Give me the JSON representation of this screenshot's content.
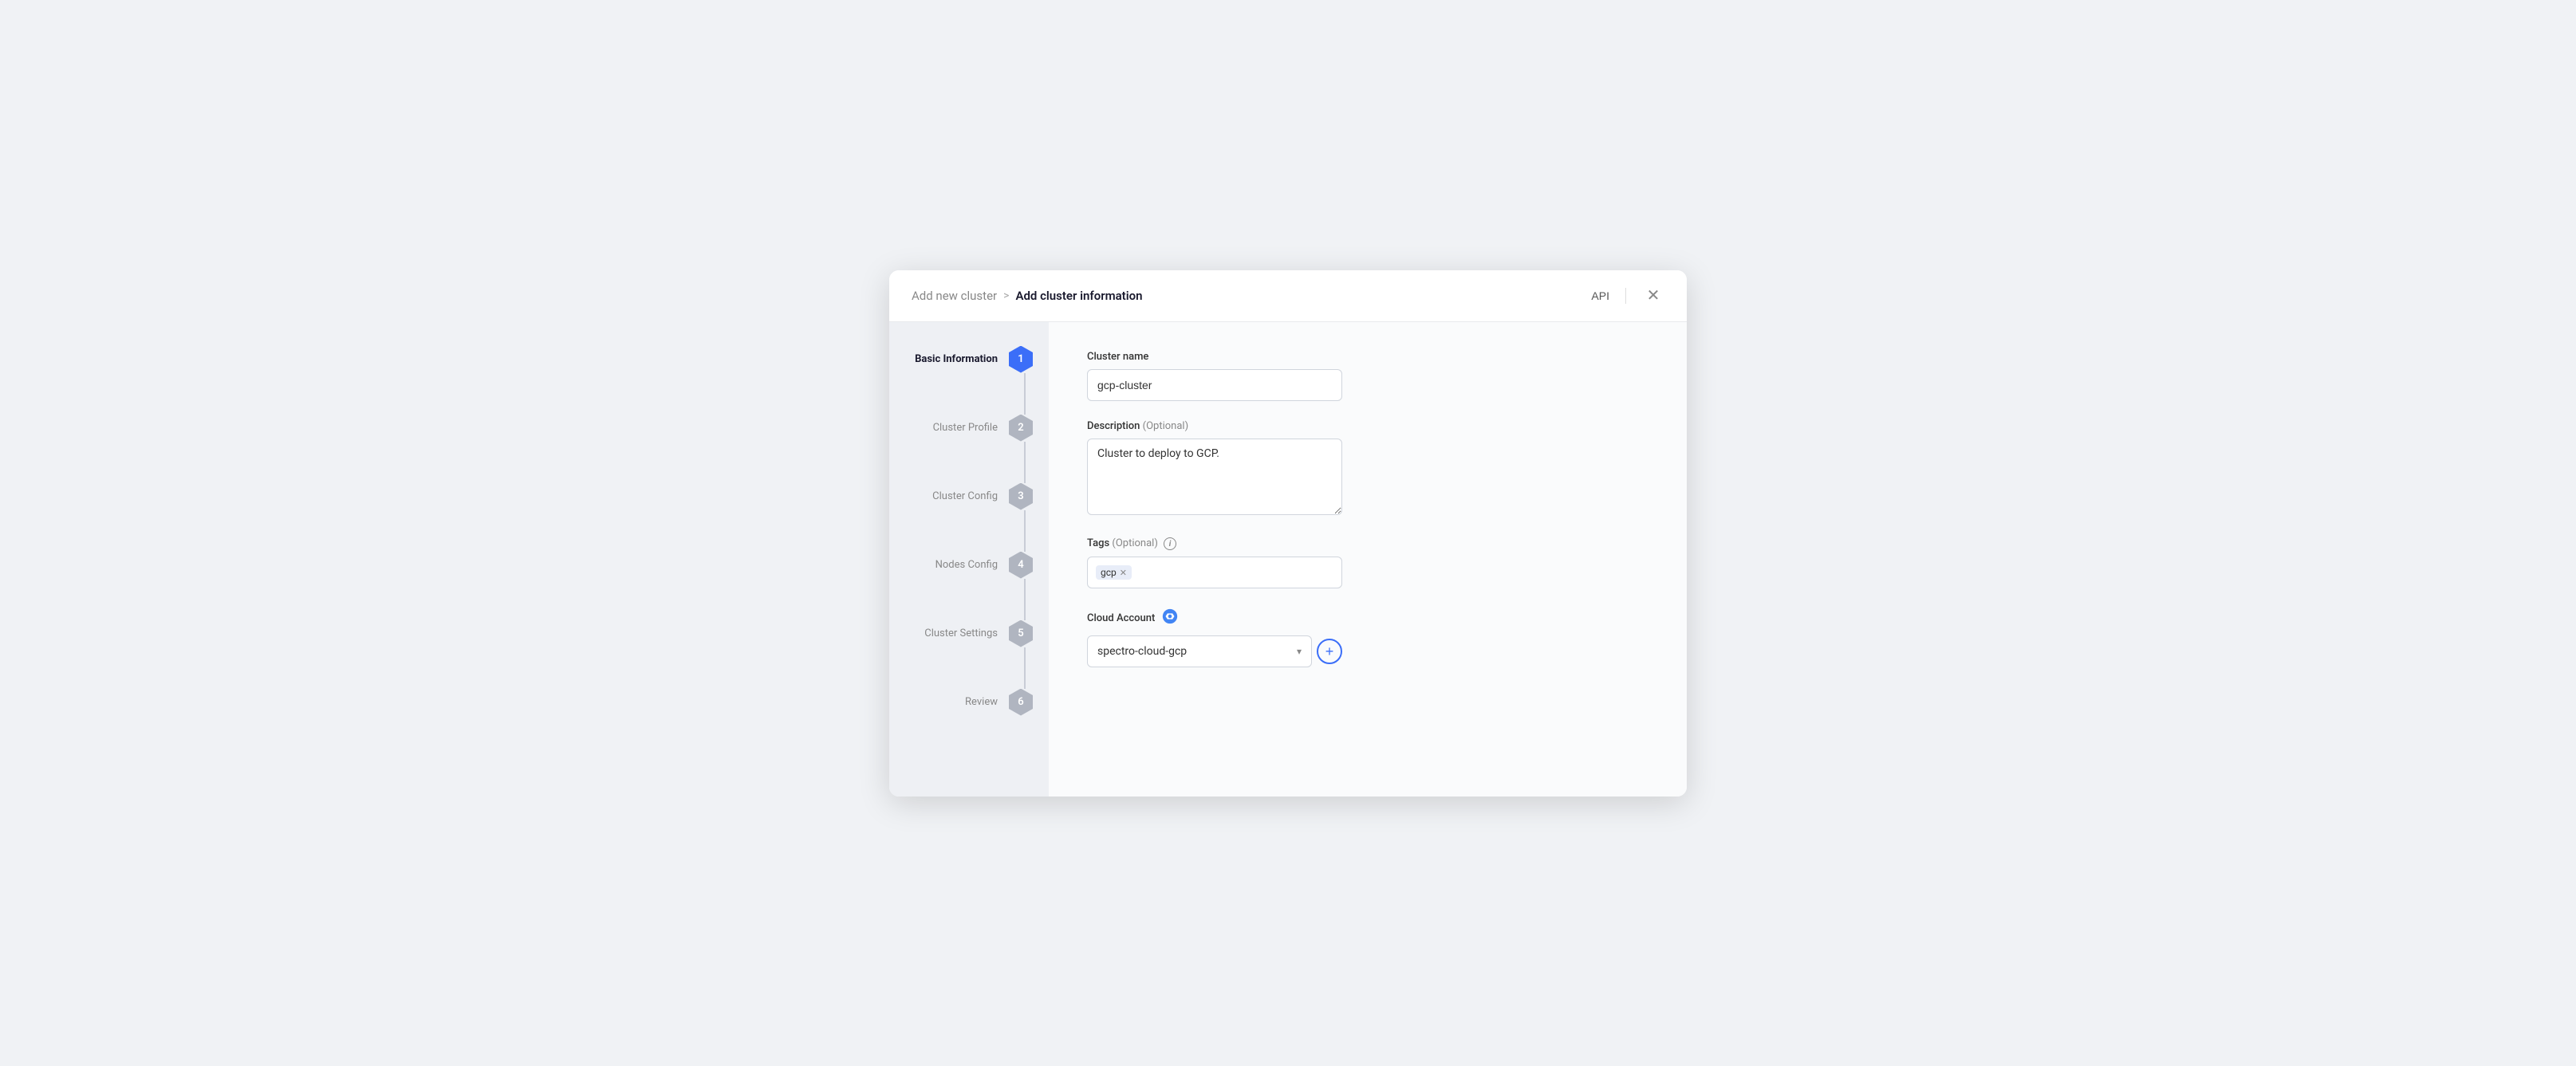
{
  "header": {
    "breadcrumb_parent": "Add new cluster",
    "breadcrumb_separator": ">",
    "breadcrumb_current": "Add cluster information",
    "api_label": "API",
    "close_icon": "✕"
  },
  "sidebar": {
    "steps": [
      {
        "label": "Basic Information",
        "number": "1",
        "active": true
      },
      {
        "label": "Cluster Profile",
        "number": "2",
        "active": false
      },
      {
        "label": "Cluster Config",
        "number": "3",
        "active": false
      },
      {
        "label": "Nodes Config",
        "number": "4",
        "active": false
      },
      {
        "label": "Cluster Settings",
        "number": "5",
        "active": false
      },
      {
        "label": "Review",
        "number": "6",
        "active": false
      }
    ]
  },
  "form": {
    "cluster_name_label": "Cluster name",
    "cluster_name_value": "gcp-cluster",
    "description_label": "Description",
    "description_optional": "(Optional)",
    "description_value": "Cluster to deploy to GCP.",
    "tags_label": "Tags",
    "tags_optional": "(Optional)",
    "tags_info_icon": "i",
    "tags": [
      {
        "value": "gcp"
      }
    ],
    "cloud_account_label": "Cloud Account",
    "cloud_account_icon": "🌐",
    "cloud_account_selected": "spectro-cloud-gcp",
    "add_account_icon": "+"
  }
}
